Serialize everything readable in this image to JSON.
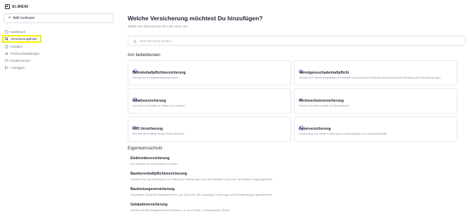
{
  "brand": {
    "name": "SI.WEIN"
  },
  "sidebar": {
    "add_label": "Add contracts",
    "items": [
      {
        "label": "Dashboard",
        "icon": "dashboard-icon"
      },
      {
        "label": "Versicherungsfinder",
        "icon": "search-icon",
        "active": true
      },
      {
        "label": "Schaden",
        "icon": "document-icon"
      },
      {
        "label": "Profil & Einstellungen",
        "icon": "settings-icon"
      },
      {
        "label": "Kundenservice",
        "icon": "support-icon"
      },
      {
        "label": "Ausloggen",
        "icon": "logout-icon"
      }
    ]
  },
  "main": {
    "title": "Welche Versicherung möchtest Du hinzufügen?",
    "subtitle": "Wähle eine Deckung aus der Liste unten aus",
    "search_placeholder": "Nach Deckung suchen",
    "popular_heading": "Am beliebtesten",
    "popular": [
      {
        "name": "Betriebshaftpflichtversicherung",
        "desc": "Schützt vor Schadenersatzansprüchen",
        "icon": "umbrella-icon"
      },
      {
        "name": "Vermögensschadenhaftpflicht",
        "desc": "Schützt für Entscheidungsträger und Berater vor finanziellen Verlusten durch fehlerhafte Beratung oder Dienstleistungen.",
        "icon": "coins-icon"
      },
      {
        "name": "Inhaltsversicherung",
        "desc": "Schützt vor Schäden an Waren und Geräten",
        "icon": "box-icon"
      },
      {
        "name": "Rechtsschutzversicherung",
        "desc": "Schützt vor hohen Kosten bei Rechtsstreit",
        "icon": "gear-icon"
      },
      {
        "name": "KFZ-Versicherung",
        "desc": "Schütze die Kraftfahrzeuge Deines Betriebs",
        "icon": "truck-icon"
      },
      {
        "name": "Cyberversicherung",
        "desc": "Schützt Dich vor hohen Kosten durch Hackerangriffe und Cyberkriminalität",
        "icon": "laptop-icon"
      }
    ],
    "property_heading": "Eigentumsschutz",
    "property": [
      {
        "name": "Elektronikversicherung",
        "desc": "Für Schäden an elektronischen Geräten"
      },
      {
        "name": "Bauherrenhaftpflichtversicherung",
        "desc": "Schützen Sie sich als Bauherr vor Haftung für Verletzungen auf Ihrer Baustelle, auch wenn die Arbeiten ausgelagert sind"
      },
      {
        "name": "Bauleistungsversicherung",
        "desc": "Essentieller Schutz für Bauunternehmer, der Schutz für alle bauseitigen Lieferungen und Dienstleistungen gewährleistet"
      },
      {
        "name": "Gebäudeversicherung",
        "desc": "Schützt das Betriebsgebäude bei Schäden u.a. durch Feuer, Leitungswasser, Sturm"
      }
    ]
  },
  "colors": {
    "highlight": "#f4f000",
    "text": "#1f2433",
    "muted": "#8a8f9c",
    "border": "#e6e8ec"
  }
}
